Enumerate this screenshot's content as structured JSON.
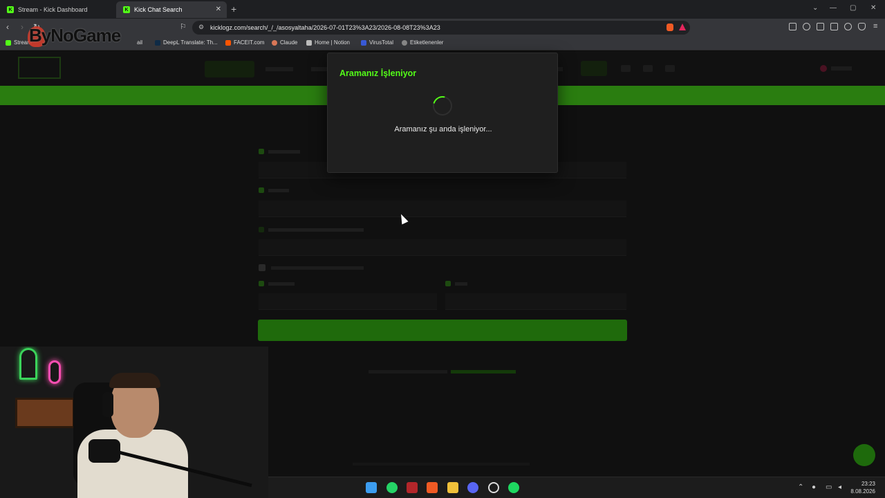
{
  "browser": {
    "tabs": [
      {
        "label": "Stream - Kick Dashboard",
        "active": false
      },
      {
        "label": "Kick Chat Search",
        "active": true
      }
    ],
    "url": "kicklogz.com/search/_/_/asosyaltaha/2026-07-01T23%3A23/2026-08-08T23%3A23",
    "bookmarks": [
      "Stream",
      "ail",
      "DeepL Translate: Th...",
      "FACEIT.com",
      "Claude",
      "Home | Notion",
      "VirusTotal",
      "Etiketlenenler"
    ],
    "watermark": "ByNoGame"
  },
  "modal": {
    "title": "Aramanız İşleniyor",
    "message": "Aramanız şu anda işleniyor..."
  },
  "taskbar": {
    "time": "23:23",
    "date": "8.08.2026"
  },
  "colors": {
    "accent": "#53fc18",
    "modal_bg": "#1f1f1f",
    "page_bg": "#101010"
  },
  "icons": [
    "back-icon",
    "forward-icon",
    "reload-icon",
    "bookmark-icon",
    "site-info-icon",
    "brave-shield-icon",
    "extensions-icon",
    "spinner-icon",
    "windows-start-icon",
    "whatsapp-icon",
    "brave-icon",
    "file-explorer-icon",
    "discord-icon",
    "spotify-icon"
  ]
}
